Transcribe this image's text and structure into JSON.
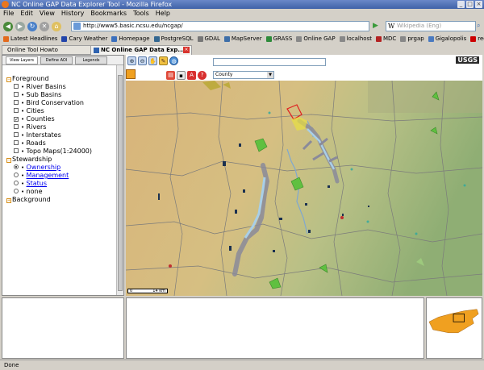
{
  "window": {
    "title": "NC Online GAP Data Explorer Tool - Mozilla Firefox"
  },
  "menu": [
    "File",
    "Edit",
    "View",
    "History",
    "Bookmarks",
    "Tools",
    "Help"
  ],
  "url": "http://www5.basic.ncsu.edu/ncgap/",
  "search_placeholder": "Wikipedia (Eng)",
  "search_engine": "W",
  "bookmarks": [
    {
      "label": "Latest Headlines",
      "color": "#e36b1d"
    },
    {
      "label": "Cary Weather",
      "color": "#2244aa"
    },
    {
      "label": "Homepage",
      "color": "#3a6fbd"
    },
    {
      "label": "PostgreSQL",
      "color": "#336791"
    },
    {
      "label": "GDAL",
      "color": "#777777"
    },
    {
      "label": "MapServer",
      "color": "#3d6ea8"
    },
    {
      "label": "GRASS",
      "color": "#2e8b3b"
    },
    {
      "label": "Online GAP",
      "color": "#888888"
    },
    {
      "label": "localhost",
      "color": "#888888"
    },
    {
      "label": "MDC",
      "color": "#b32222"
    },
    {
      "label": "prgap",
      "color": "#888888"
    },
    {
      "label": "Gigalopolis",
      "color": "#4a7ac0"
    },
    {
      "label": "redhat",
      "color": "#cc0000"
    }
  ],
  "tabs": {
    "left_tab": "Online Tool Howto",
    "active_tab": "NC Online GAP Data Exp..."
  },
  "sidebar": {
    "tabs": [
      "View Layers",
      "Define AOI",
      "Legends"
    ],
    "foreground": {
      "label": "Foreground",
      "items": [
        {
          "label": "River Basins",
          "checked": false
        },
        {
          "label": "Sub Basins",
          "checked": false
        },
        {
          "label": "Bird Conservation",
          "checked": false
        },
        {
          "label": "Cities",
          "checked": false
        },
        {
          "label": "Counties",
          "checked": true
        },
        {
          "label": "Rivers",
          "checked": false
        },
        {
          "label": "Interstates",
          "checked": false
        },
        {
          "label": "Roads",
          "checked": false
        },
        {
          "label": "Topo Maps(1:24000)",
          "checked": false
        }
      ]
    },
    "stewardship": {
      "label": "Stewardship",
      "items": [
        {
          "label": "Ownership",
          "selected": true
        },
        {
          "label": "Management",
          "selected": false
        },
        {
          "label": "Status",
          "selected": false
        },
        {
          "label": "none",
          "selected": false
        }
      ]
    },
    "background": {
      "label": "Background"
    }
  },
  "map": {
    "select_value": "County",
    "logo": "USGS",
    "scale_left": "0",
    "scale_right": "14 km"
  },
  "status": "Done"
}
